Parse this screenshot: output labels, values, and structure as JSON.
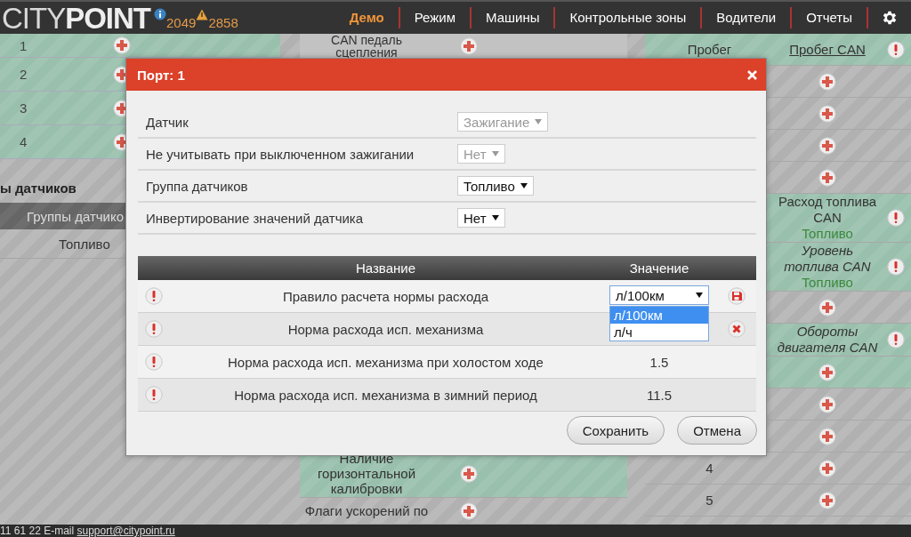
{
  "header": {
    "logo": "CITY**POINT**",
    "info_count": "2049",
    "warning_count": "2858",
    "nav": [
      {
        "label": "Демо",
        "selected": true
      },
      {
        "label": "Режим",
        "selected": false
      },
      {
        "label": "Машины",
        "selected": false
      },
      {
        "label": "Контрольные зоны",
        "selected": false
      },
      {
        "label": "Водители",
        "selected": false
      },
      {
        "label": "Отчеты",
        "selected": false
      }
    ]
  },
  "left_table": {
    "rows": [
      {
        "number": "1",
        "highlighted": true
      },
      {
        "number": "2",
        "highlighted": true
      },
      {
        "number": "3",
        "highlighted": true
      },
      {
        "number": "4",
        "highlighted": true
      }
    ],
    "groups_heading": "ы датчиков",
    "groups_column": "Группы датчико",
    "groups": [
      "Топливо"
    ]
  },
  "middle_table": {
    "top_row": {
      "name": "CAN педаль сцепления",
      "highlighted": false
    },
    "bottom_rows": [
      {
        "name": "Наличие горизонтальной калибровки",
        "highlighted": true
      },
      {
        "name": "Флаги ускорений по",
        "highlighted": false
      }
    ]
  },
  "right_table": {
    "rows": [
      {
        "kind": "sensor",
        "column_1": "Пробег",
        "name": "Пробег CAN",
        "linked": true,
        "italic": false,
        "highlighted": true
      },
      {
        "kind": "add",
        "highlighted": false
      },
      {
        "kind": "add",
        "highlighted": false
      },
      {
        "kind": "add",
        "highlighted": false
      },
      {
        "kind": "add",
        "highlighted": false
      },
      {
        "kind": "sensor",
        "name": "Расход топлива CAN",
        "group": "Топливо",
        "linked": false,
        "italic": false,
        "highlighted": true
      },
      {
        "kind": "sensor",
        "name": "Уровень топлива CAN",
        "group": "Топливо",
        "linked": false,
        "italic": true,
        "highlighted": true
      },
      {
        "kind": "add",
        "highlighted": false
      },
      {
        "kind": "sensor",
        "name": "Обороты двигателя CAN",
        "linked": false,
        "italic": true,
        "highlighted": true
      },
      {
        "kind": "add",
        "highlighted": true
      },
      {
        "kind": "add",
        "highlighted": false
      },
      {
        "kind": "add",
        "highlighted": false
      },
      {
        "kind": "add",
        "column_1": "4",
        "highlighted": false
      },
      {
        "kind": "add",
        "column_1": "5",
        "highlighted": false
      }
    ]
  },
  "footer": {
    "text": "11 61 22 E-mail ",
    "email": "support@citypoint.ru"
  },
  "dialog": {
    "title": "Порт: 1",
    "fields": [
      {
        "label": "Датчик",
        "value": "Зажигание",
        "disabled": true
      },
      {
        "label": "Не учитывать при выключенном зажигании",
        "value": "Нет",
        "disabled": true
      },
      {
        "label": "Группа датчиков",
        "value": "Топливо",
        "disabled": false
      },
      {
        "label": "Инвертирование значений датчика",
        "value": "Нет",
        "disabled": false
      }
    ],
    "columns": [
      "Название",
      "Значение"
    ],
    "rows": [
      {
        "name": "Правило расчета нормы расхода",
        "kind": "select",
        "value": "л/100км",
        "action": {
          "kind": "save"
        },
        "options": [
          {
            "label": "л/100км",
            "selected": true
          },
          {
            "label": "л/ч",
            "selected": false
          }
        ]
      },
      {
        "name": "Норма расхода исп. механизма",
        "kind": "hidden",
        "action": {
          "kind": "delete"
        }
      },
      {
        "name": "Норма расхода исп. механизма при холостом ходе",
        "kind": "text",
        "value": "1.5"
      },
      {
        "name": "Норма расхода исп. механизма в зимний период",
        "kind": "text",
        "value": "11.5"
      }
    ],
    "buttons": [
      "Сохранить",
      "Отмена"
    ]
  }
}
